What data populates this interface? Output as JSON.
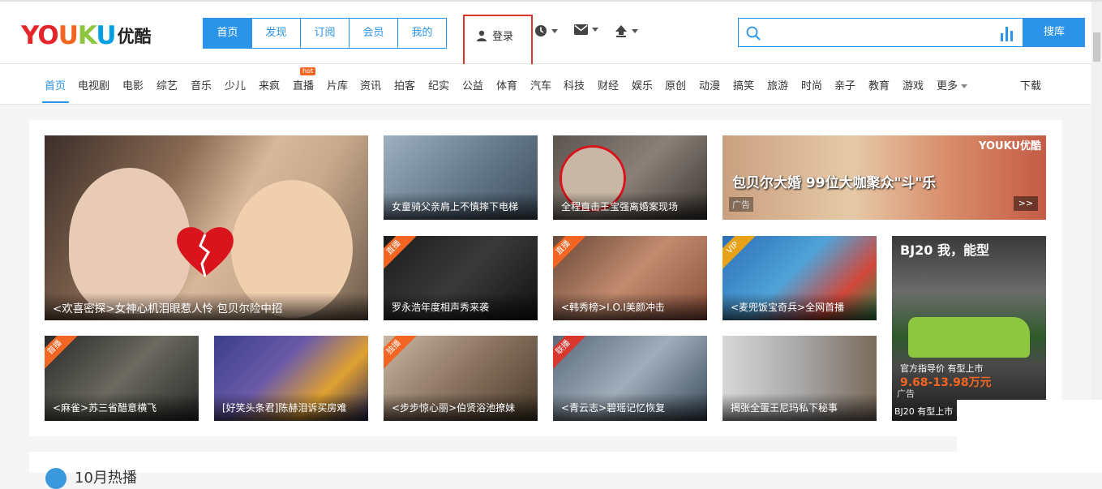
{
  "logo": {
    "latin": "YOUKU",
    "chinese": "优酷"
  },
  "nav_tabs": [
    {
      "label": "首页",
      "active": true
    },
    {
      "label": "发现",
      "active": false
    },
    {
      "label": "订阅",
      "active": false
    },
    {
      "label": "会员",
      "active": false
    },
    {
      "label": "我的",
      "active": false
    }
  ],
  "login": {
    "label": "登录",
    "icon": "user-icon"
  },
  "header_icons": [
    "clock-icon",
    "mail-icon",
    "upload-icon"
  ],
  "search": {
    "placeholder": "",
    "value": "",
    "button_label": "搜库"
  },
  "categories": {
    "items": [
      "首页",
      "电视剧",
      "电影",
      "综艺",
      "音乐",
      "少儿",
      "来疯",
      "直播",
      "片库",
      "资讯",
      "拍客",
      "纪实",
      "公益",
      "体育",
      "汽车",
      "科技",
      "财经",
      "娱乐",
      "原创",
      "动漫",
      "搞笑",
      "旅游",
      "时尚",
      "亲子",
      "教育",
      "游戏",
      "更多"
    ],
    "hot_badge": "hot",
    "download_label": "下载"
  },
  "tiles": {
    "hero": {
      "title": "<欢喜密探>女神心机泪眼惹人怜 包贝尔险中招"
    },
    "t1": {
      "title": "女童骑父亲肩上不慎摔下电梯"
    },
    "t2": {
      "title": "全程直击王宝强离婚案现场"
    },
    "ad_banner": {
      "ad_label": "广告",
      "next_label": ">>",
      "overlay_text": "包贝尔大婚 99位大咖聚众\"斗\"乐",
      "brand": "YOUKU优酷"
    },
    "t3": {
      "title": "罗永浩年度相声秀来袭",
      "badge": "直播"
    },
    "t4": {
      "title": "<韩秀榜>I.O.I美颜冲击",
      "badge": "直播"
    },
    "t5": {
      "title": "<麦兜饭宝奇兵>全网首播",
      "badge": "VIP"
    },
    "car_ad": {
      "ad_label": "广告",
      "caption": "BJ20 有型上市",
      "headline": "BJ20 我，能型",
      "price_label": "官方指导价 有型上市",
      "price": "9.68-13.98万元"
    },
    "t6": {
      "title": "<麻雀>苏三省醋意横飞",
      "badge": "首播"
    },
    "t7": {
      "title": "[好笑头条君]陈赫泪诉买房难"
    },
    "t8": {
      "title": "<步步惊心丽>伯贤浴池撩妹",
      "badge": "独播"
    },
    "t9": {
      "title": "<青云志>碧瑶记忆恢复",
      "badge": "联播"
    },
    "t10": {
      "title": "揭张全蛋王尼玛私下秘事"
    }
  },
  "section2": {
    "title": "10月热播"
  }
}
